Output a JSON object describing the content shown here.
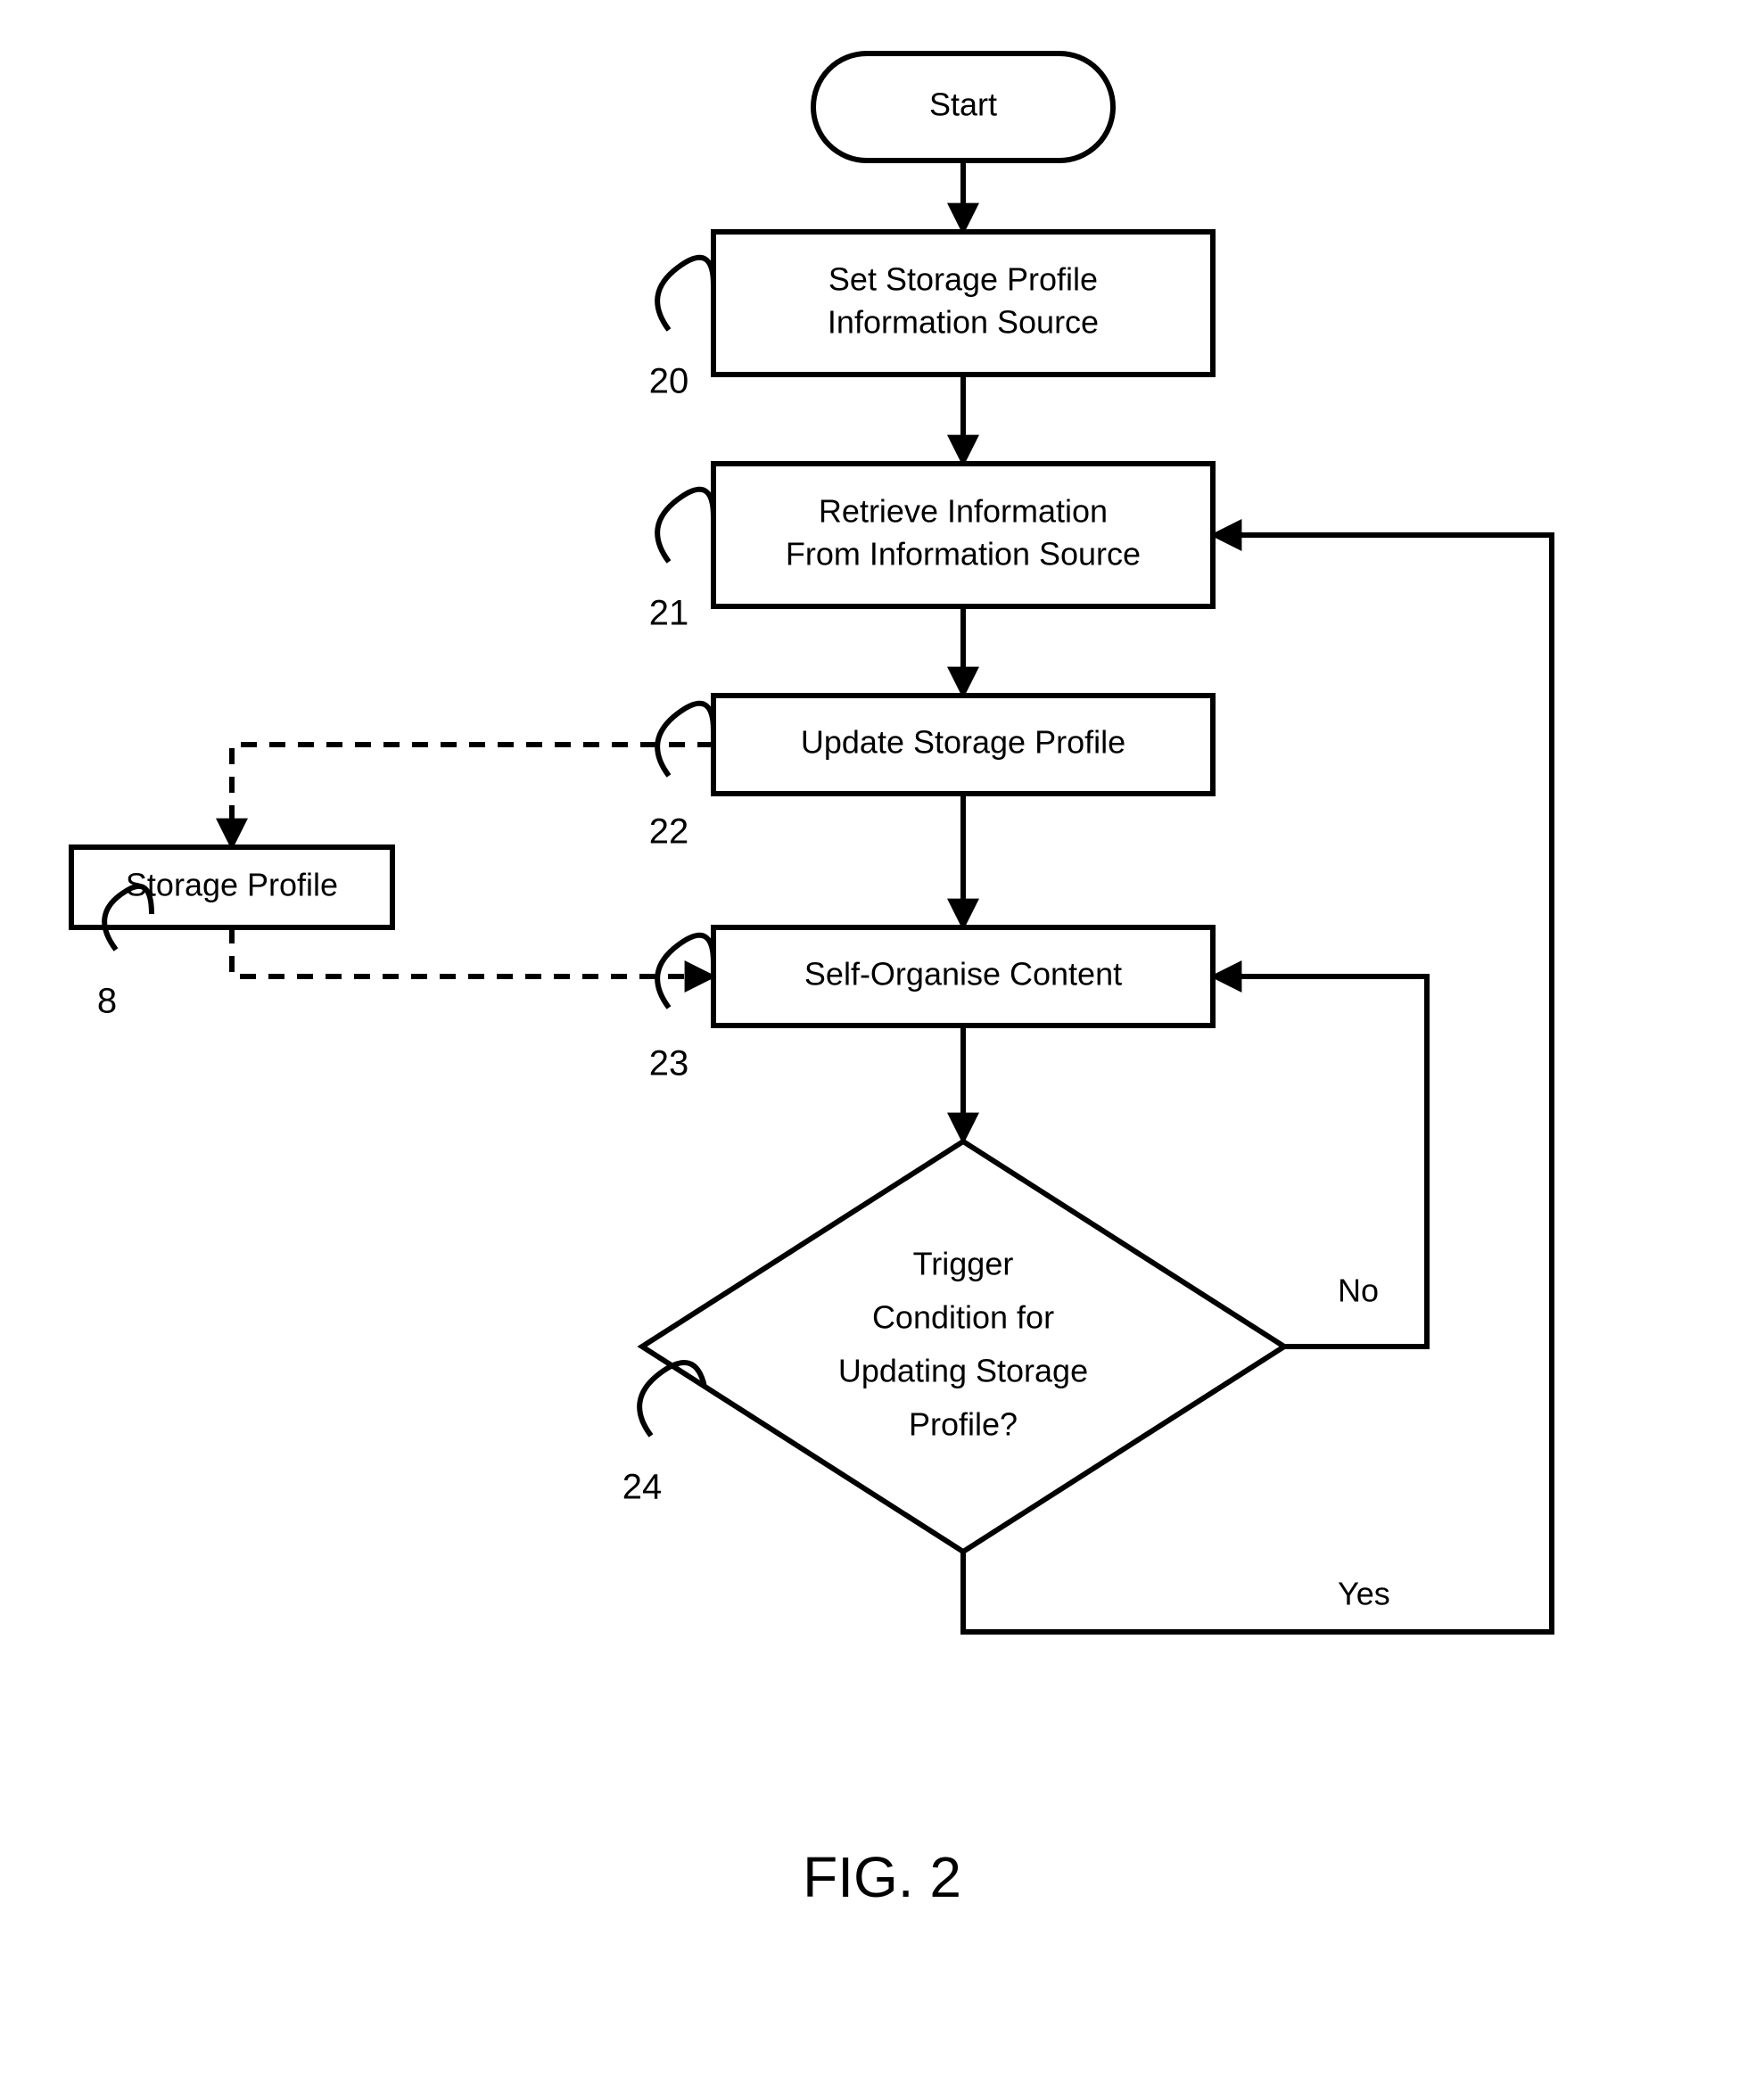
{
  "figure_label": "FIG. 2",
  "nodes": {
    "start": {
      "text": "Start"
    },
    "set_source": {
      "line1": "Set Storage Profile",
      "line2": "Information Source",
      "ref": "20"
    },
    "retrieve": {
      "line1": "Retrieve Information",
      "line2": "From Information Source",
      "ref": "21"
    },
    "update": {
      "text": "Update Storage Profile",
      "ref": "22"
    },
    "organise": {
      "text": "Self-Organise Content",
      "ref": "23"
    },
    "trigger": {
      "line1": "Trigger",
      "line2": "Condition for",
      "line3": "Updating Storage",
      "line4": "Profile?",
      "ref": "24"
    },
    "storage_profile": {
      "text": "Storage Profile",
      "ref": "8"
    }
  },
  "edges": {
    "no": "No",
    "yes": "Yes"
  }
}
